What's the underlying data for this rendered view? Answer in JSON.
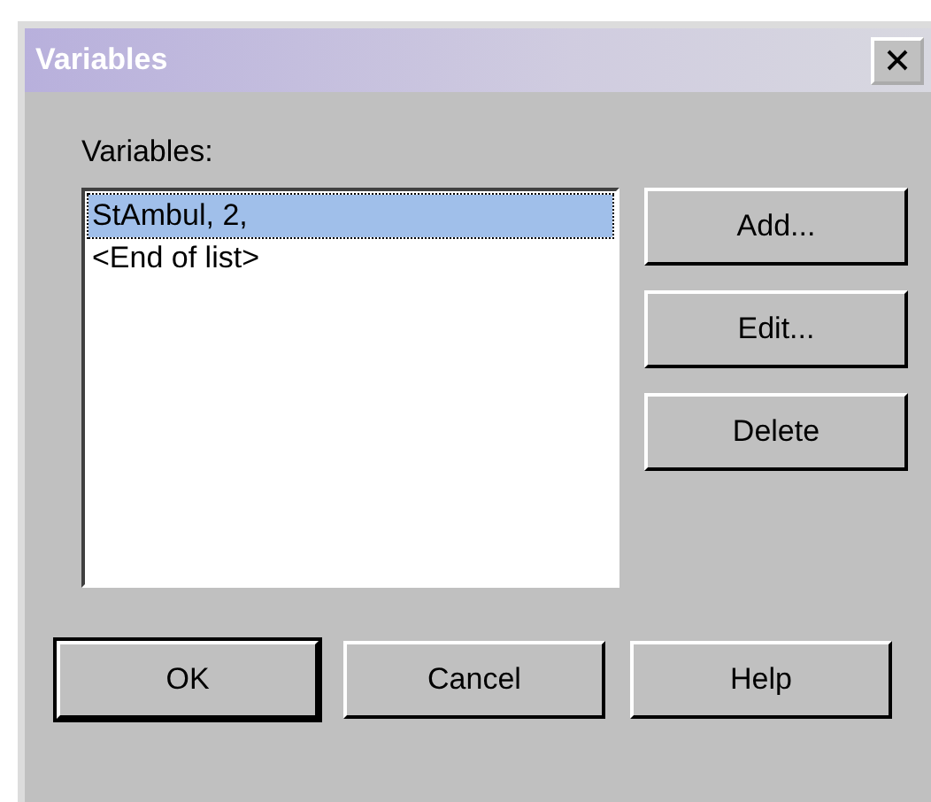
{
  "window": {
    "title": "Variables"
  },
  "list": {
    "label": "Variables:",
    "items": [
      {
        "text": "StAmbul, 2,",
        "selected": true
      },
      {
        "text": "<End of list>",
        "selected": false
      }
    ]
  },
  "side_buttons": [
    "Add...",
    "Edit...",
    "Delete"
  ],
  "buttons": [
    {
      "label": "OK",
      "default": true
    },
    {
      "label": "Cancel",
      "default": false
    },
    {
      "label": "Help",
      "default": false
    }
  ]
}
